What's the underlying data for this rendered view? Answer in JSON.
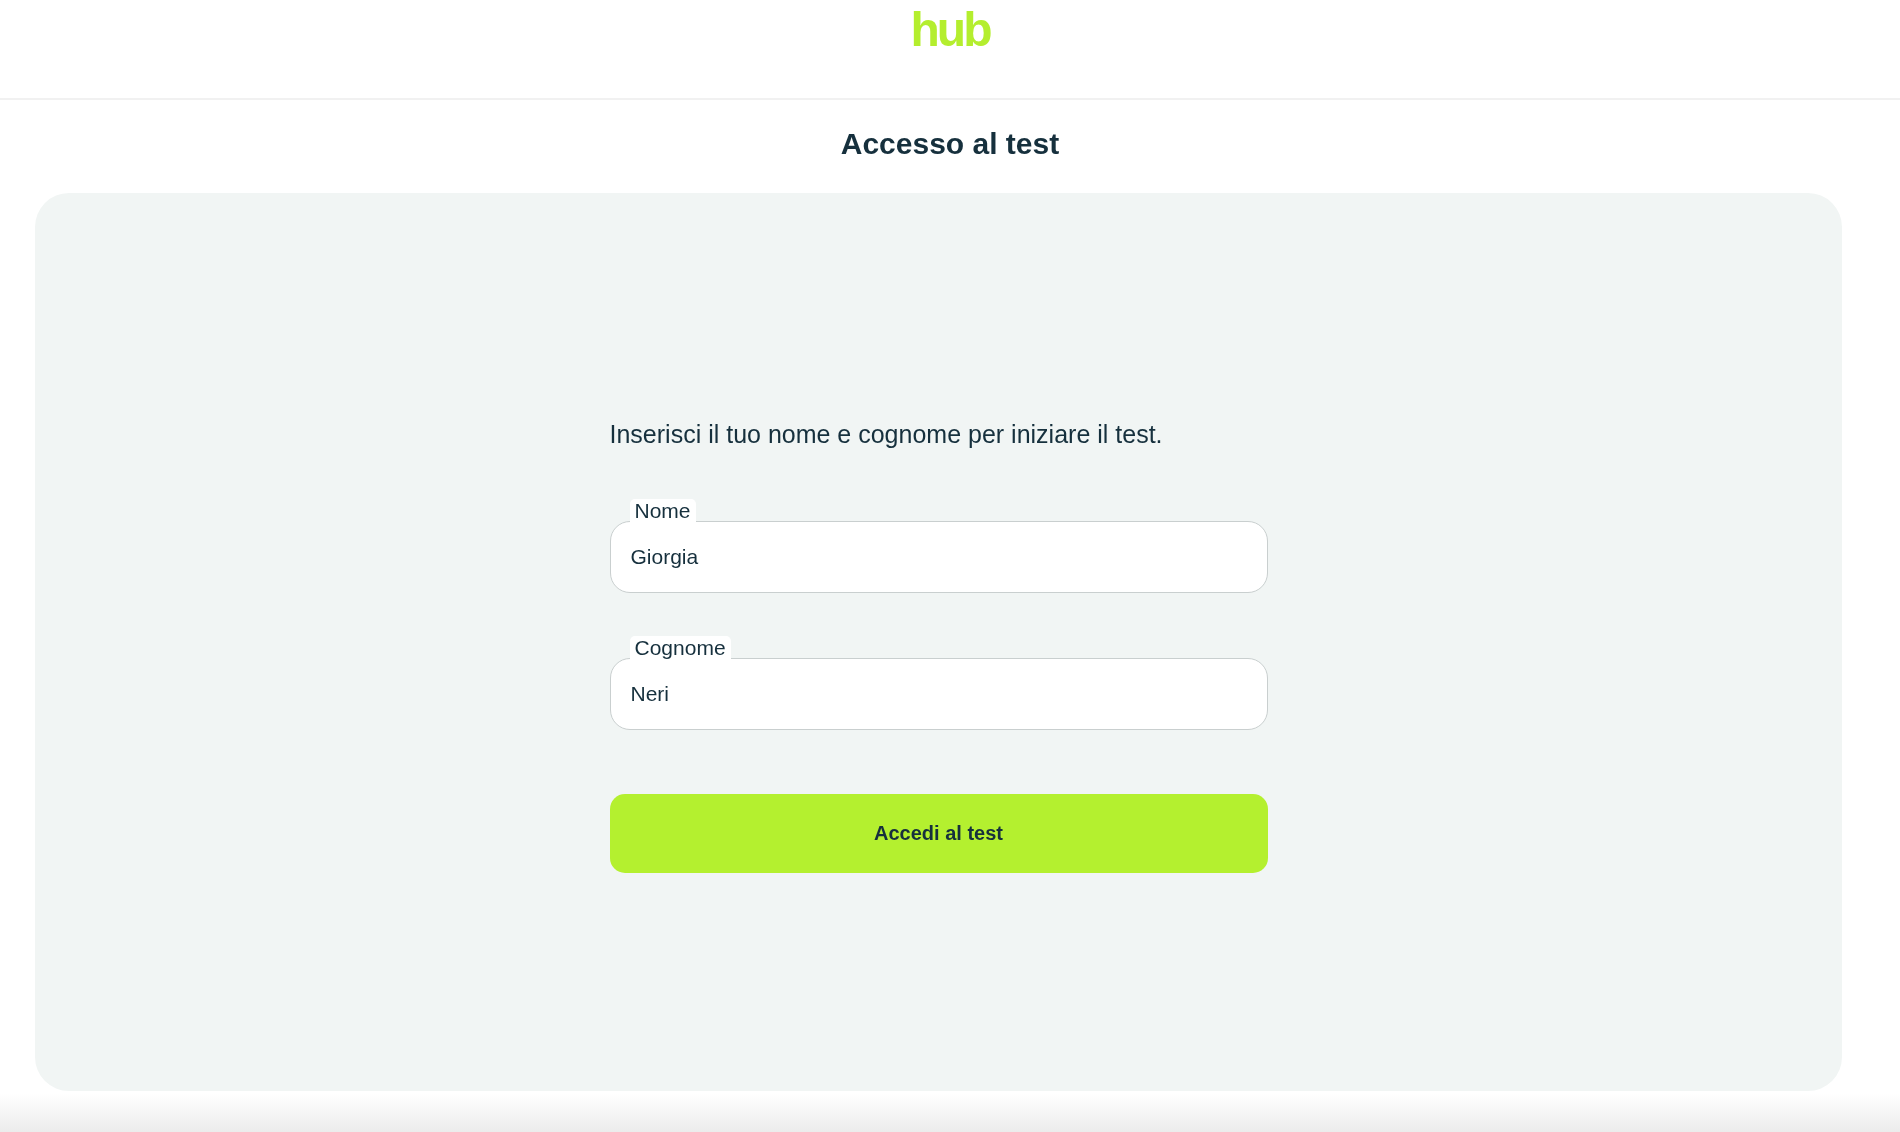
{
  "header": {
    "logo": "hub"
  },
  "title": "Accesso al test",
  "form": {
    "instructions": "Inserisci il tuo nome e cognome per iniziare il test.",
    "fields": [
      {
        "label": "Nome",
        "value": "Giorgia"
      },
      {
        "label": "Cognome",
        "value": "Neri"
      }
    ],
    "submit_button": "Accedi al test"
  }
}
